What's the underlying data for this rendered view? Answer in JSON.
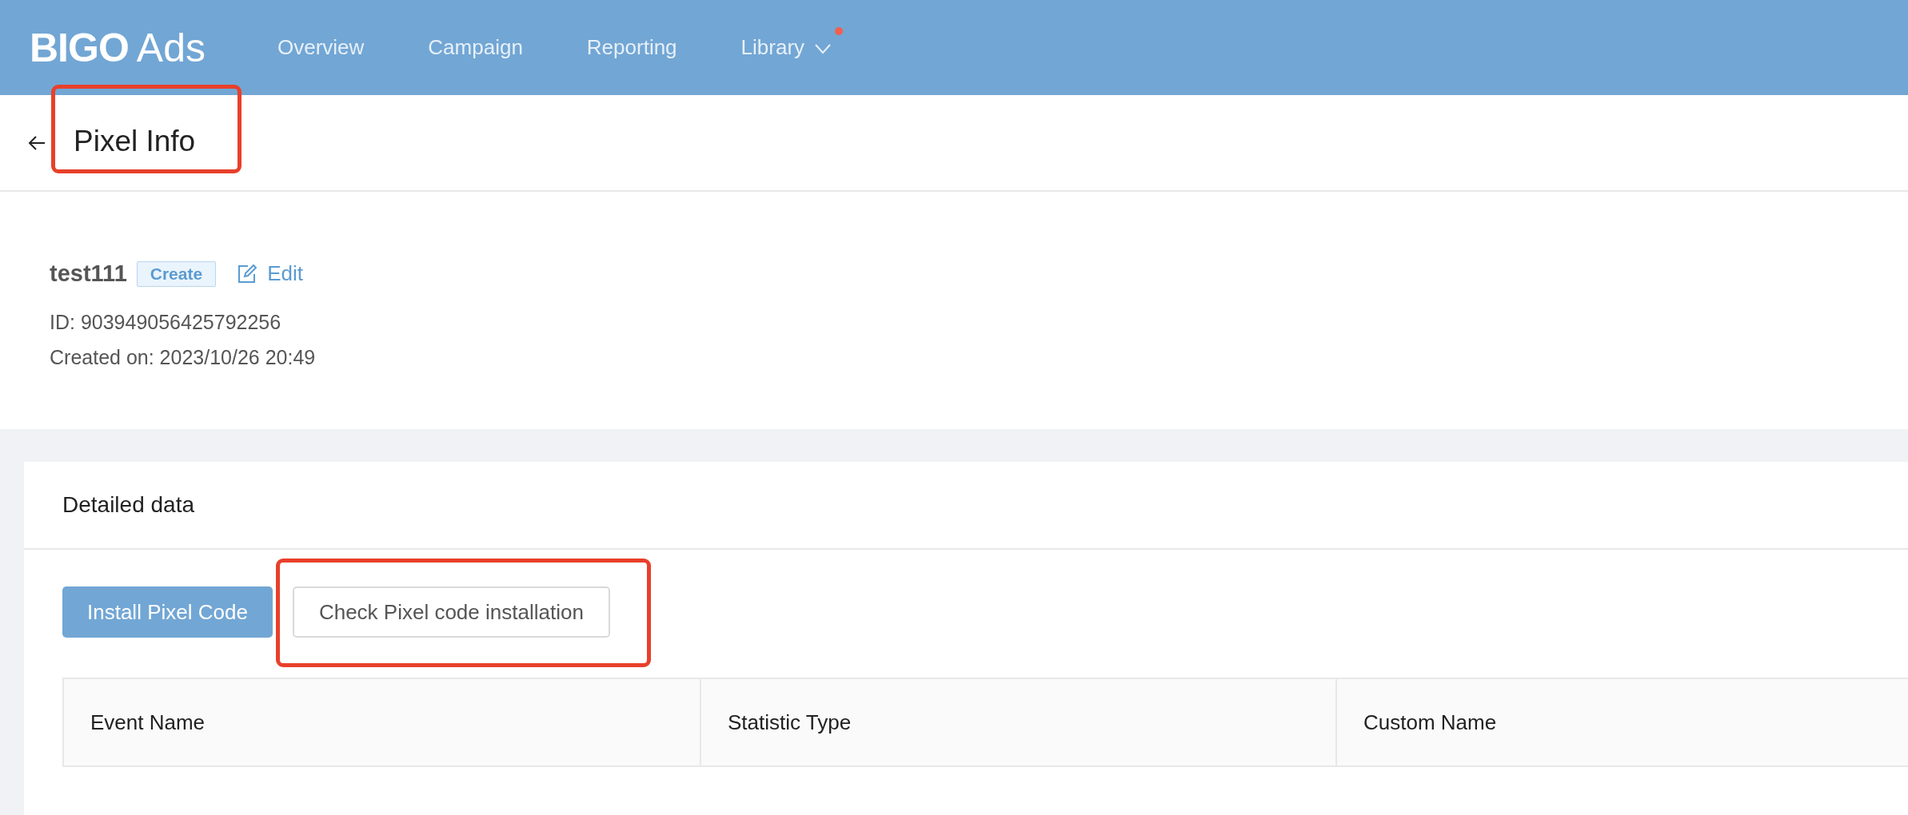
{
  "header": {
    "logo": {
      "brand": "BIGO",
      "suffix": "Ads"
    },
    "nav": [
      {
        "label": "Overview",
        "dropdown": false,
        "dot": false
      },
      {
        "label": "Campaign",
        "dropdown": false,
        "dot": false
      },
      {
        "label": "Reporting",
        "dropdown": false,
        "dot": false
      },
      {
        "label": "Library",
        "dropdown": true,
        "dot": true
      }
    ]
  },
  "page": {
    "title": "Pixel Info",
    "highlighted": true
  },
  "pixel": {
    "name": "test111",
    "status": "Create",
    "edit": "Edit",
    "id": "ID: 903949056425792256",
    "created": "Created on: 2023/10/26 20:49"
  },
  "detail": {
    "title": "Detailed data",
    "buttons": [
      {
        "label": "Install Pixel Code",
        "kind": "primary",
        "highlighted": false
      },
      {
        "label": "Check Pixel code installation",
        "kind": "default",
        "highlighted": true
      }
    ],
    "table": {
      "columns": [
        "Event Name",
        "Statistic Type",
        "Custom Name"
      ]
    }
  }
}
